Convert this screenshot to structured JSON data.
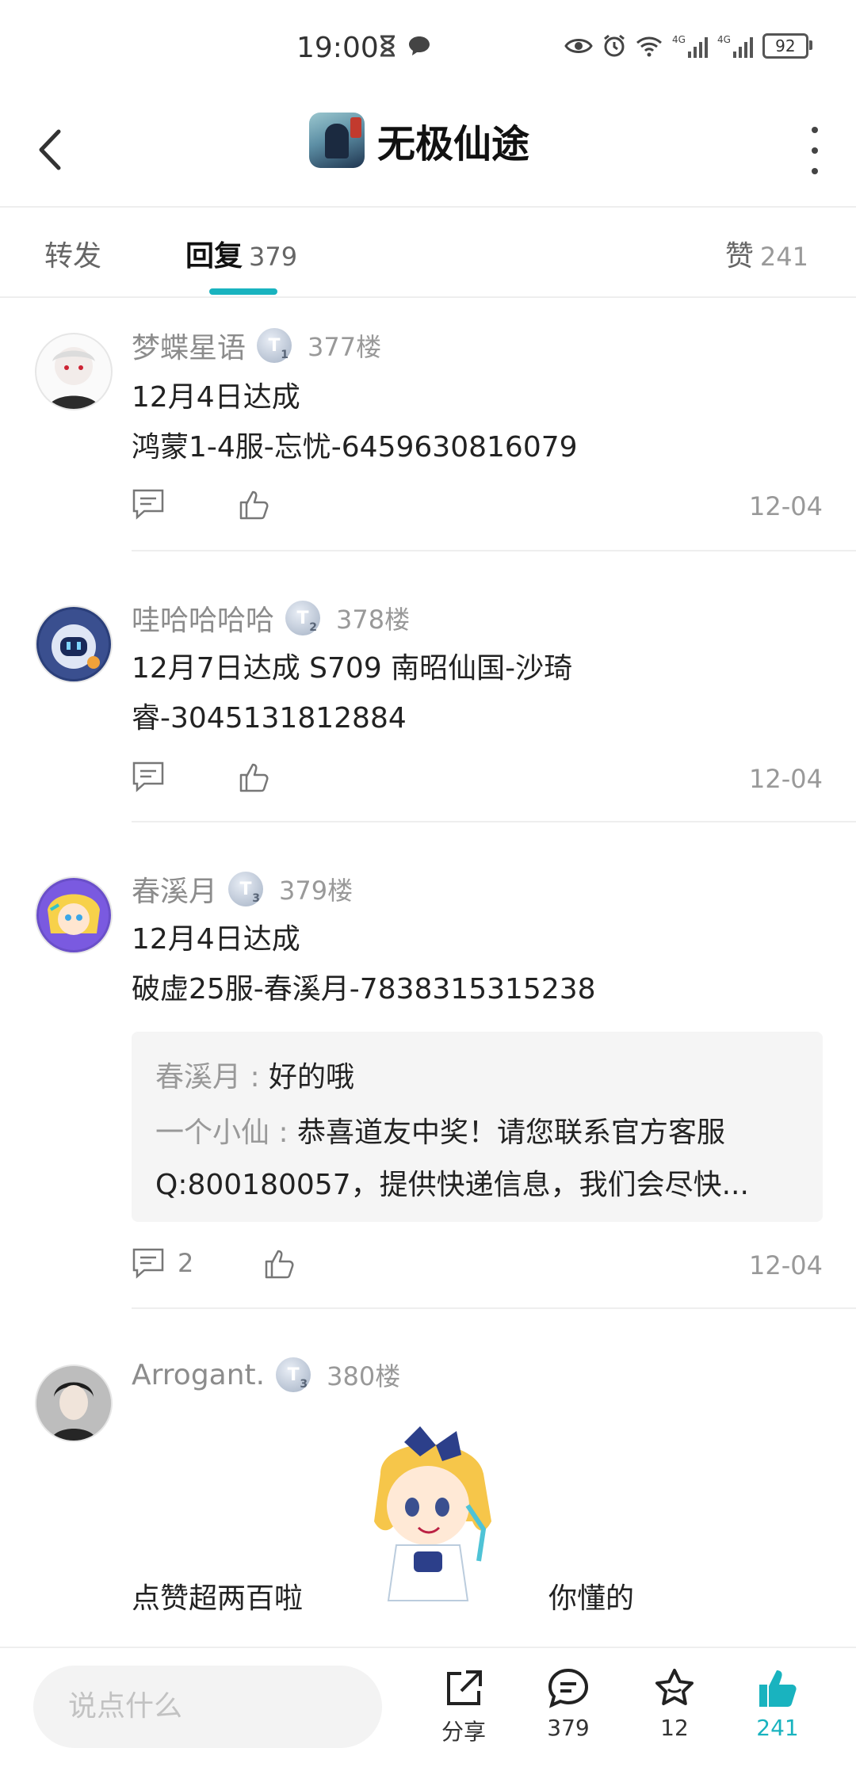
{
  "status_bar": {
    "time": "19:00",
    "battery": "92",
    "net1": "4G",
    "net2": "4G"
  },
  "header": {
    "title": "无极仙途"
  },
  "tabs": {
    "forward": "转发",
    "reply": "回复",
    "reply_count": "379",
    "like": "赞",
    "like_count": "241"
  },
  "posts": [
    {
      "user": "梦蝶星语",
      "level": "T",
      "level_num": "1",
      "floor": "377楼",
      "lines": [
        "12月4日达成",
        "鸿蒙1-4服-忘忧-6459630816079"
      ],
      "date": "12-04"
    },
    {
      "user": "哇哈哈哈哈",
      "level": "T",
      "level_num": "2",
      "floor": "378楼",
      "lines": [
        "12月7日达成 S709 南昭仙国-沙琦",
        "睿-3045131812884"
      ],
      "date": "12-04"
    },
    {
      "user": "春溪月",
      "level": "T",
      "level_num": "3",
      "floor": "379楼",
      "lines": [
        "12月4日达成",
        "破虚25服-春溪月-7838315315238"
      ],
      "replies": [
        {
          "who": "春溪月",
          "sep": " : ",
          "text": "好的哦"
        },
        {
          "who": "一个小仙",
          "sep": " : ",
          "text": "恭喜道友中奖！请您联系官方客服"
        },
        {
          "who": "",
          "sep": "",
          "text": "Q:800180057，提供快递信息，我们会尽快..."
        }
      ],
      "comment_count": "2",
      "date": "12-04"
    },
    {
      "user": "Arrogant.",
      "level": "T",
      "level_num": "3",
      "floor": "380楼",
      "caption_left": "点赞超两百啦",
      "caption_right": "你懂的"
    }
  ],
  "bottom_bar": {
    "input_placeholder": "说点什么",
    "share": "分享",
    "comments": "379",
    "favorites": "12",
    "likes": "241"
  },
  "colors": {
    "accent": "#19b3bf",
    "text": "#222222",
    "muted": "#999999"
  }
}
